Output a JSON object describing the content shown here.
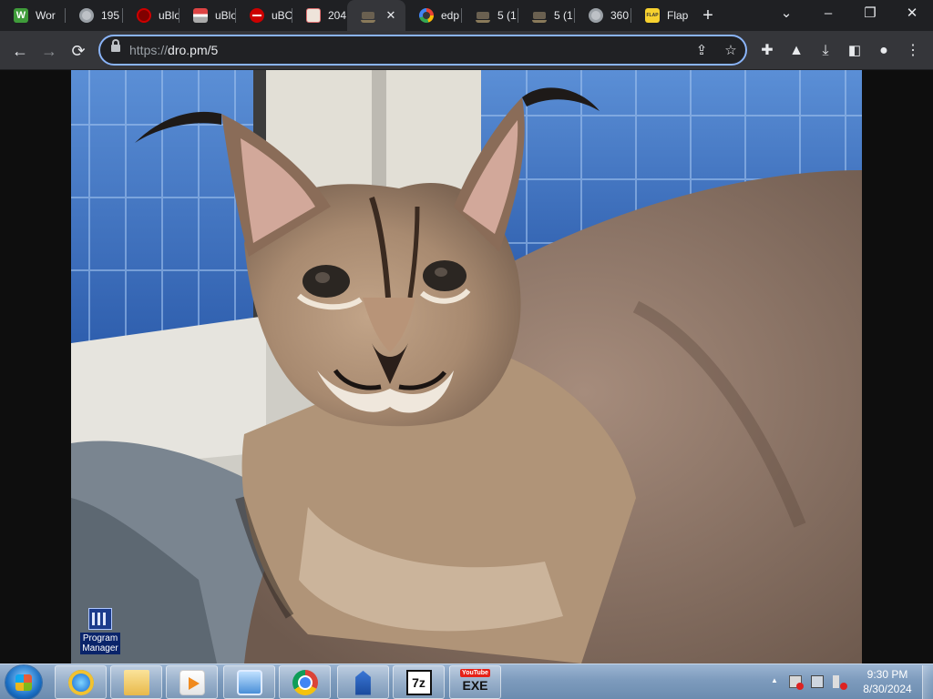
{
  "browser": {
    "tabs": [
      {
        "title": "Wor",
        "favicon": "w-green-icon"
      },
      {
        "title": "195",
        "favicon": "globe-icon"
      },
      {
        "title": "uBlo",
        "favicon": "ublock-icon"
      },
      {
        "title": "uBlo",
        "favicon": "ublock-image-icon"
      },
      {
        "title": "uBO",
        "favicon": "stop-icon"
      },
      {
        "title": "204",
        "favicon": "2048-icon"
      },
      {
        "title": "",
        "favicon": "cat-photo-icon",
        "active": true
      },
      {
        "title": "edp",
        "favicon": "google-icon"
      },
      {
        "title": "5 (1",
        "favicon": "cat-photo-icon"
      },
      {
        "title": "5 (1",
        "favicon": "cat-photo-icon"
      },
      {
        "title": "360",
        "favicon": "globe-icon"
      },
      {
        "title": "Flap",
        "favicon": "flappy-icon"
      }
    ],
    "new_tab_label": "+",
    "window_controls": {
      "minimize": "–",
      "restore": "❐",
      "close": "✕",
      "tab_search": "⌄"
    },
    "toolbar": {
      "back": "←",
      "forward": "→",
      "reload": "⟳"
    },
    "url": {
      "scheme": "https://",
      "host_path": "dro.pm/5"
    },
    "accent_color": "#8ab4f8"
  },
  "desktop": {
    "icon_label_line1": "Program",
    "icon_label_line2": "Manager"
  },
  "taskbar": {
    "pinned": [
      "internet-explorer-icon",
      "file-explorer-icon",
      "media-player-icon",
      "control-panel-icon",
      "chrome-icon",
      "building-app-icon",
      "7zip-icon",
      "youtube-exe-icon"
    ],
    "sevenzip_label": "7z",
    "yt_label": "YouTube",
    "exe_label": "EXE",
    "tray_arrow": "▲",
    "clock_time": "9:30 PM",
    "clock_date": "8/30/2024"
  }
}
